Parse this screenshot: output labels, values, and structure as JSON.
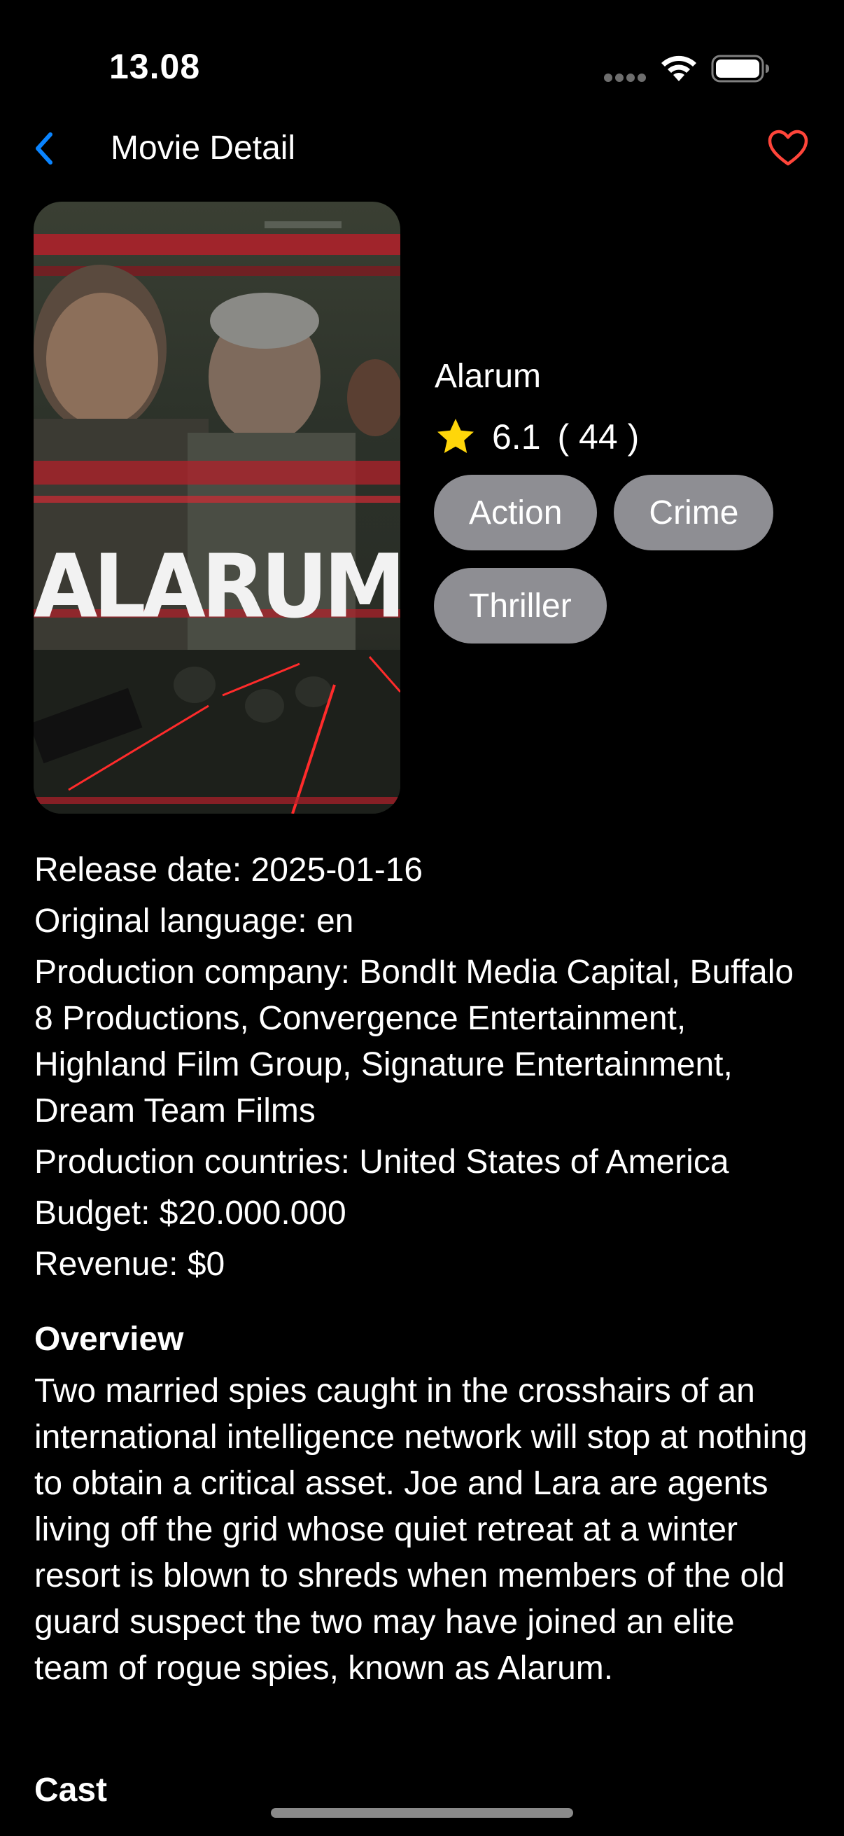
{
  "status_bar": {
    "time": "13.08",
    "icons": [
      "cellular-signal-icon",
      "wifi-icon",
      "battery-icon"
    ]
  },
  "nav": {
    "back_icon": "chevron-left-icon",
    "title": "Movie Detail",
    "favorite_icon": "heart-outline-icon"
  },
  "movie": {
    "poster_text": "ALARUM",
    "title": "Alarum",
    "rating": "6.1",
    "vote_count": "( 44 )",
    "genres": [
      "Action",
      "Crime",
      "Thriller"
    ]
  },
  "details": {
    "release_date": "Release date: 2025-01-16",
    "original_language": "Original language: en",
    "production_company": "Production company: BondIt Media Capital, Buffalo 8 Productions, Convergence Entertainment, Highland Film Group, Signature Entertainment, Dream Team Films",
    "production_countries": "Production countries: United States of America",
    "budget": "Budget: $20.000.000",
    "revenue": "Revenue: $0"
  },
  "overview": {
    "heading": "Overview",
    "text": "Two married spies caught in the crosshairs of an international intelligence network will stop at nothing to obtain a critical asset. Joe and Lara are agents living off the grid whose quiet retreat at a winter resort is blown to shreds when members of the old guard suspect the two may have joined an elite team of rogue spies, known as Alarum."
  },
  "cast": {
    "heading": "Cast"
  },
  "colors": {
    "accent_blue": "#0A84FF",
    "favorite_red": "#FF453A",
    "star_yellow": "#FFD60A",
    "chip_gray": "#8E8E93",
    "background": "#000000"
  }
}
